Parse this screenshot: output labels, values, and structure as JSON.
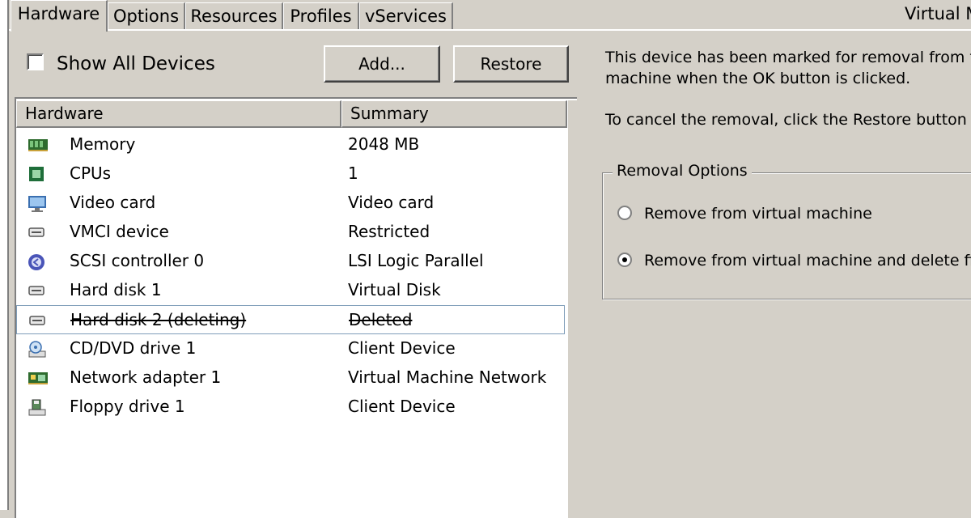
{
  "tabs": [
    {
      "label": "Hardware",
      "active": true
    },
    {
      "label": "Options",
      "active": false
    },
    {
      "label": "Resources",
      "active": false
    },
    {
      "label": "Profiles",
      "active": false
    },
    {
      "label": "vServices",
      "active": false
    }
  ],
  "window_title_partial": "Virtual M",
  "show_all_devices": {
    "label": "Show All Devices",
    "checked": false
  },
  "buttons": {
    "add": "Add...",
    "restore": "Restore"
  },
  "hardware_table": {
    "columns": [
      "Hardware",
      "Summary"
    ],
    "rows": [
      {
        "icon": "memory-icon",
        "name": "Memory",
        "summary": "2048 MB"
      },
      {
        "icon": "cpu-icon",
        "name": "CPUs",
        "summary": "1"
      },
      {
        "icon": "monitor-icon",
        "name": "Video card",
        "summary": "Video card"
      },
      {
        "icon": "device-icon",
        "name": "VMCI device",
        "summary": "Restricted"
      },
      {
        "icon": "scsi-controller-icon",
        "name": "SCSI controller 0",
        "summary": "LSI Logic Parallel"
      },
      {
        "icon": "hard-disk-icon",
        "name": "Hard disk 1",
        "summary": "Virtual Disk"
      },
      {
        "icon": "hard-disk-icon",
        "name": "Hard disk 2 (deleting)",
        "summary": "Deleted",
        "deleting": true,
        "selected": true
      },
      {
        "icon": "cd-dvd-icon",
        "name": "CD/DVD drive 1",
        "summary": "Client Device"
      },
      {
        "icon": "network-adapter-icon",
        "name": "Network adapter 1",
        "summary": "Virtual Machine Network"
      },
      {
        "icon": "floppy-drive-icon",
        "name": "Floppy drive 1",
        "summary": "Client Device"
      }
    ]
  },
  "info": {
    "line1": "This device has been marked for removal from t",
    "line2": "machine when the OK button is clicked.",
    "line3": "To cancel the removal, click the Restore button"
  },
  "removal_options": {
    "legend": "Removal Options",
    "options": [
      {
        "label": "Remove from virtual machine",
        "selected": false
      },
      {
        "label": "Remove from virtual machine and delete fi",
        "selected": true
      }
    ]
  },
  "colors": {
    "window_bg": "#d4d0c8",
    "list_bg": "#ffffff",
    "selection_border": "#7f9db9"
  }
}
